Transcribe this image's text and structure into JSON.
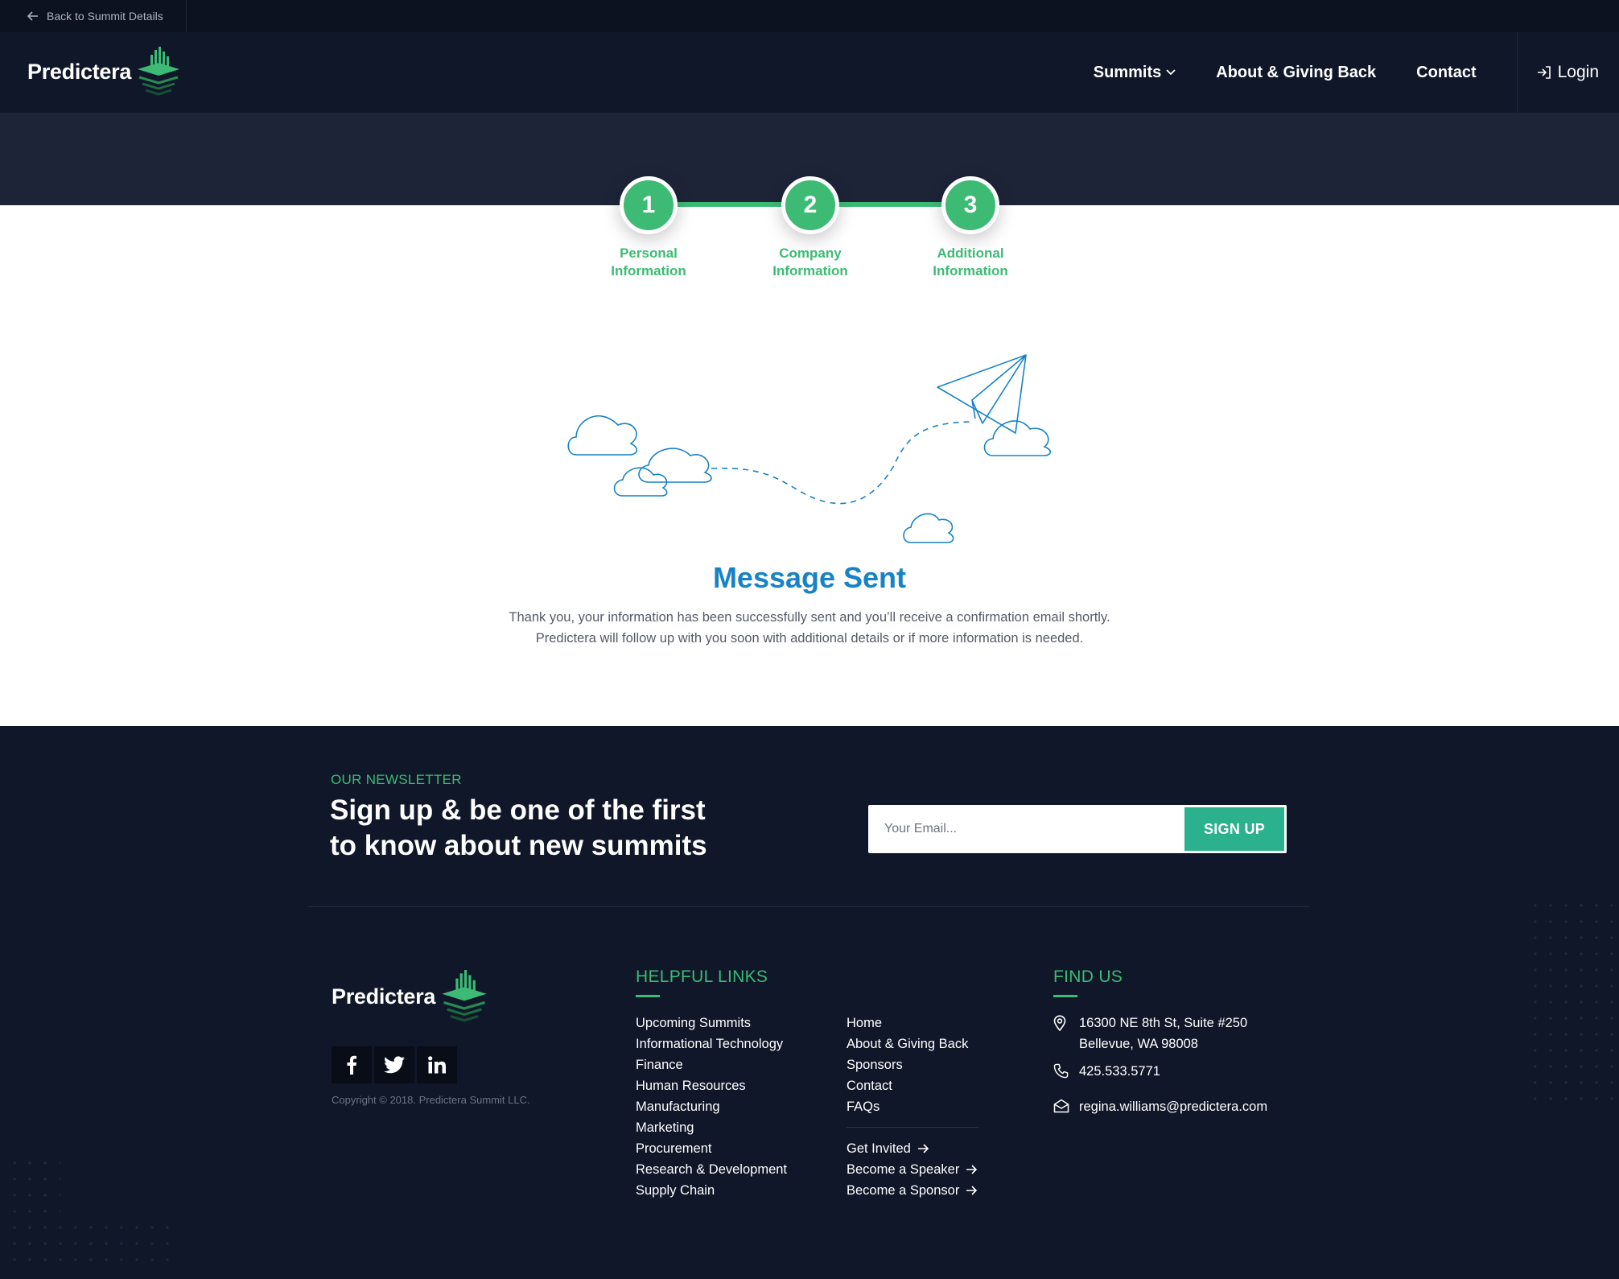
{
  "topbar": {
    "back_label": "Back to Summit Details"
  },
  "header": {
    "logo_text": "Predictera",
    "nav": {
      "summits": "Summits",
      "about": "About & Giving Back",
      "contact": "Contact",
      "login": "Login"
    }
  },
  "stepper": {
    "steps": [
      {
        "number": "1",
        "line1": "Personal",
        "line2": "Information"
      },
      {
        "number": "2",
        "line1": "Company",
        "line2": "Information"
      },
      {
        "number": "3",
        "line1": "Additional",
        "line2": "Information"
      }
    ]
  },
  "message": {
    "title": "Message Sent",
    "line1": "Thank you, your information has been successfully sent and you’ll receive a confirmation email shortly.",
    "line2": "Predictera will follow up with you soon with additional details or if more information is needed."
  },
  "newsletter": {
    "eyebrow": "OUR NEWSLETTER",
    "heading_line1": "Sign up & be one of the first",
    "heading_line2": "to know about new summits",
    "placeholder": "Your Email...",
    "button": "SIGN UP"
  },
  "footer": {
    "logo_text": "Predictera",
    "copyright": "Copyright © 2018. Predictera Summit LLC.",
    "helpful_title": "HELPFUL LINKS",
    "links_col1": [
      "Upcoming Summits",
      "Informational Technology",
      "Finance",
      "Human Resources",
      "Manufacturing",
      "Marketing",
      "Procurement",
      "Research & Development",
      "Supply Chain"
    ],
    "links_col2": [
      "Home",
      "About & Giving Back",
      "Sponsors",
      "Contact",
      "FAQs"
    ],
    "cta_links": [
      "Get Invited",
      "Become a Speaker",
      "Become a Sponsor"
    ],
    "findus_title": "FIND US",
    "address_line1": "16300 NE 8th St, Suite #250",
    "address_line2": "Bellevue, WA 98008",
    "phone": "425.533.5771",
    "email": "regina.williams@predictera.com"
  },
  "colors": {
    "accent": "#3dbb74",
    "title_blue": "#1783c6",
    "dark_navy": "#0f1729",
    "band": "#1e2438",
    "button": "#2bb18e"
  }
}
